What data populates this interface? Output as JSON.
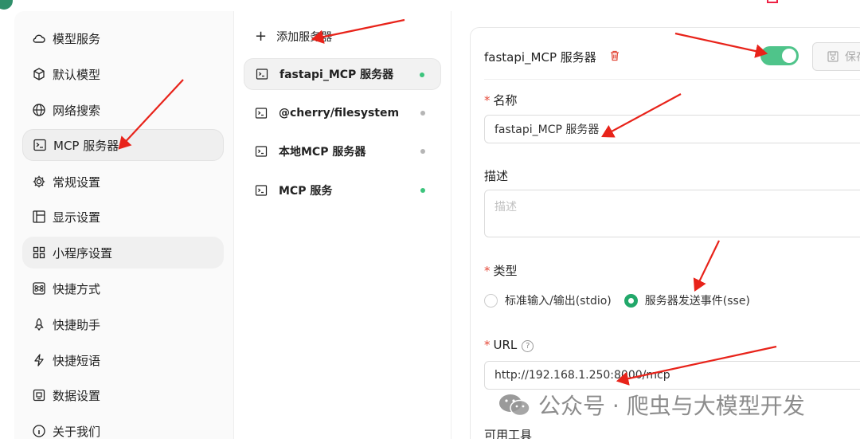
{
  "sidebar": {
    "items": [
      {
        "label": "模型服务",
        "icon": "cloud-icon"
      },
      {
        "label": "默认模型",
        "icon": "cube-icon"
      },
      {
        "label": "网络搜索",
        "icon": "globe-icon"
      },
      {
        "label": "MCP 服务器",
        "icon": "terminal-icon"
      },
      {
        "label": "常规设置",
        "icon": "gear-icon"
      },
      {
        "label": "显示设置",
        "icon": "layout-icon"
      },
      {
        "label": "小程序设置",
        "icon": "grid-icon"
      },
      {
        "label": "快捷方式",
        "icon": "command-icon"
      },
      {
        "label": "快捷助手",
        "icon": "rocket-icon"
      },
      {
        "label": "快捷短语",
        "icon": "zap-icon"
      },
      {
        "label": "数据设置",
        "icon": "database-icon"
      },
      {
        "label": "关于我们",
        "icon": "info-icon"
      }
    ]
  },
  "servers": {
    "add_label": "添加服务器",
    "list": [
      {
        "name": "fastapi_MCP 服务器",
        "status_color": "#3cc47c"
      },
      {
        "name": "@cherry/filesystem",
        "status_color": "#b5b5b5"
      },
      {
        "name": "本地MCP 服务器",
        "status_color": "#b5b5b5"
      },
      {
        "name": "MCP 服务",
        "status_color": "#3cc47c"
      }
    ]
  },
  "detail": {
    "title": "fastapi_MCP 服务器",
    "save_label": "保存",
    "enabled": true,
    "name_label": "名称",
    "name_value": "fastapi_MCP 服务器",
    "desc_label": "描述",
    "desc_placeholder": "描述",
    "type_label": "类型",
    "type_options": [
      "标准输入/输出(stdio)",
      "服务器发送事件(sse)"
    ],
    "type_selected": "服务器发送事件(sse)",
    "url_label": "URL",
    "url_value": "http://192.168.1.250:8000/mcp",
    "tools_label": "可用工具"
  },
  "watermark": "公众号 · 爬虫与大模型开发",
  "colors": {
    "accent": "#22a86a",
    "toggle_on": "#4fc48a",
    "required": "#e54a3a",
    "arrow": "#e8231a"
  }
}
